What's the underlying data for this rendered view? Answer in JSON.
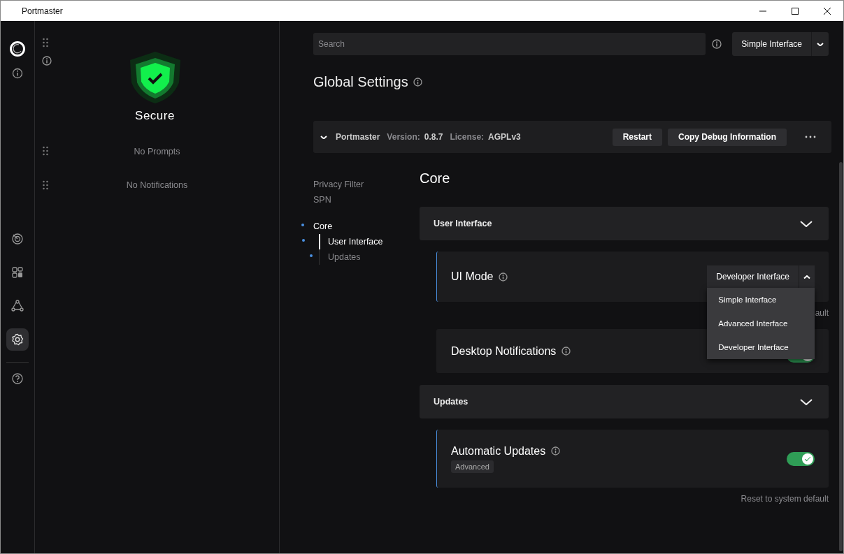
{
  "window": {
    "title": "Portmaster"
  },
  "rail": [
    {
      "kind": "logo",
      "selected": false
    },
    {
      "kind": "info",
      "selected": false
    },
    {
      "kind": "radar",
      "selected": false
    },
    {
      "kind": "apps",
      "selected": false
    },
    {
      "kind": "network",
      "selected": false
    },
    {
      "kind": "settings",
      "selected": true
    },
    {
      "kind": "help",
      "selected": false
    }
  ],
  "overview": {
    "status": "Secure",
    "prompts": "No Prompts",
    "notifications": "No Notifications"
  },
  "search": {
    "placeholder": "Search"
  },
  "mode_select": {
    "value": "Simple Interface"
  },
  "page_title": "Global Settings",
  "app_bar": {
    "name": "Portmaster",
    "version_label": "Version:",
    "version": "0.8.7",
    "license_label": "License:",
    "license": "AGPLv3",
    "buttons": [
      "Restart",
      "Copy Debug Information"
    ]
  },
  "nav": [
    {
      "label": "Privacy Filter",
      "active": false
    },
    {
      "label": "SPN",
      "active": false
    },
    {
      "label": "Core",
      "active": true,
      "children": [
        {
          "label": "User Interface",
          "active": true
        },
        {
          "label": "Updates",
          "active": false
        }
      ]
    }
  ],
  "section_title": "Core",
  "sections": [
    {
      "title": "User Interface",
      "expanded": true,
      "settings": [
        {
          "kind": "select",
          "title": "UI Mode",
          "changed": true,
          "value": "Developer Interface",
          "open": true,
          "options": [
            "Simple Interface",
            "Advanced Interface",
            "Developer Interface"
          ],
          "reset": "ault"
        },
        {
          "kind": "toggle",
          "title": "Desktop Notifications",
          "changed": false,
          "on": true
        }
      ]
    },
    {
      "title": "Updates",
      "expanded": true,
      "settings": [
        {
          "kind": "toggle",
          "title": "Automatic Updates",
          "changed": true,
          "tag": "Advanced",
          "on": true,
          "reset": "Reset to system default"
        }
      ]
    }
  ]
}
